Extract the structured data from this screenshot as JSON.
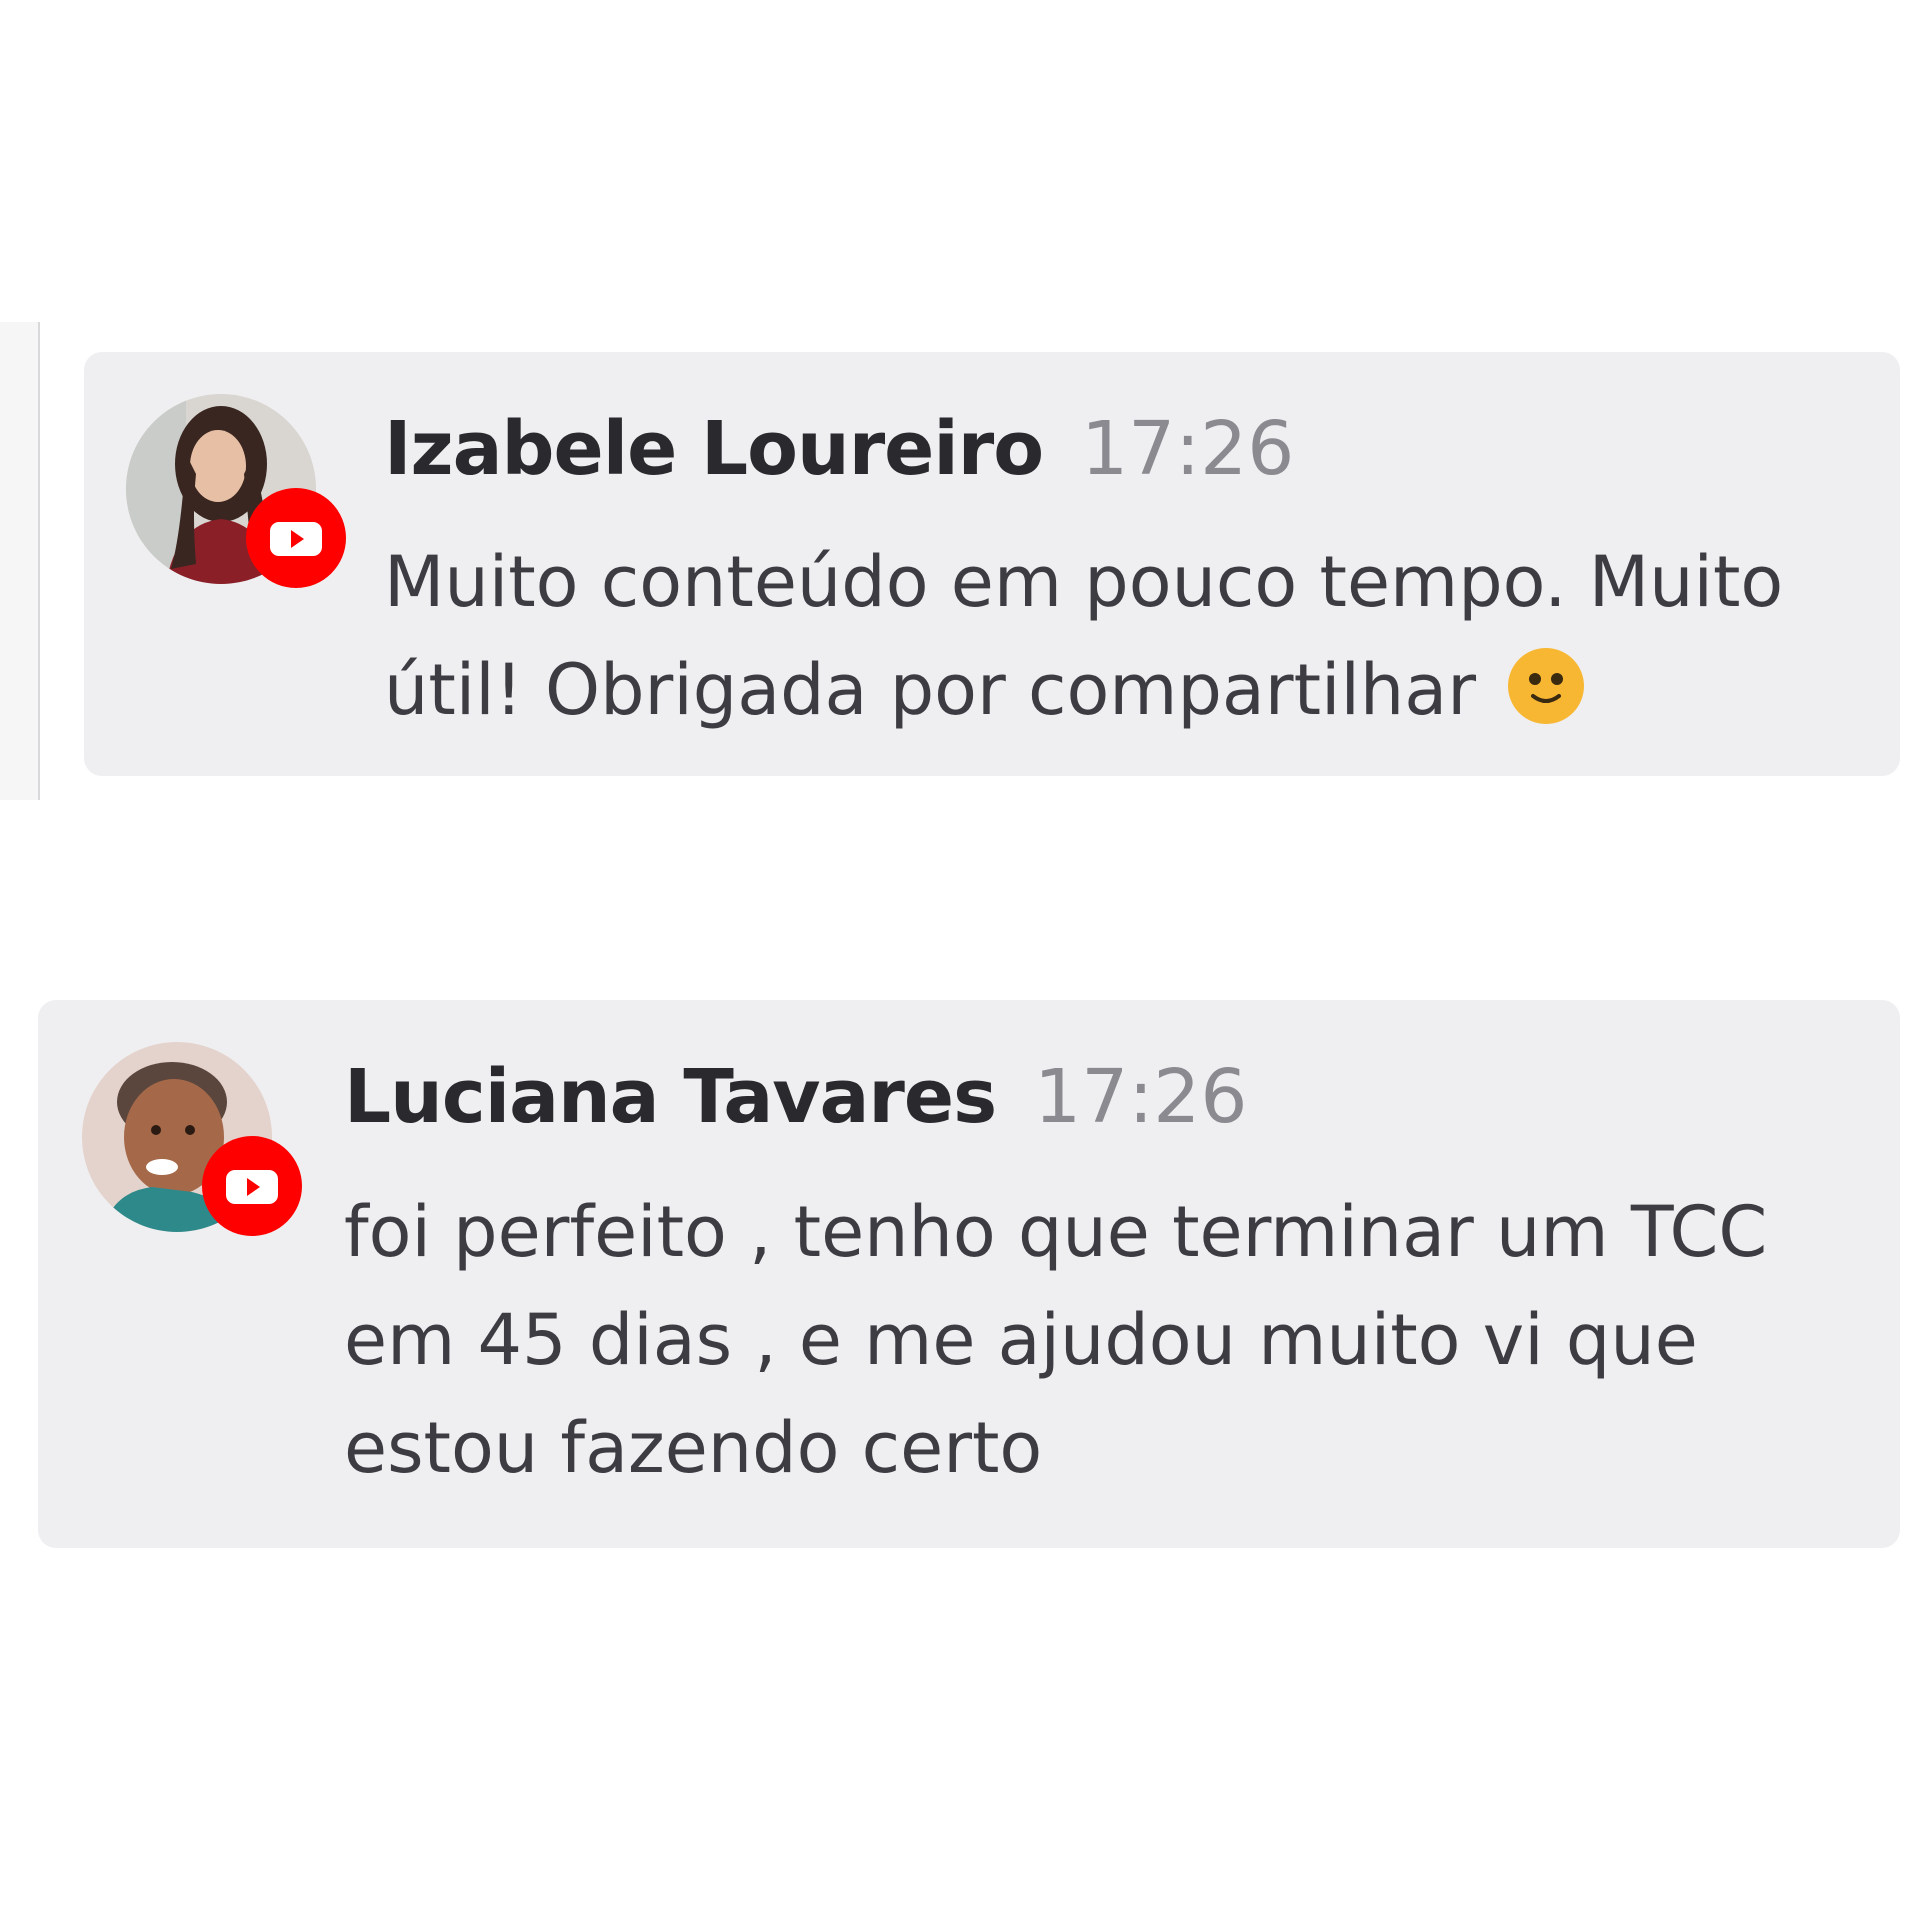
{
  "comments": [
    {
      "author": "Izabele Loureiro",
      "time": "17:26",
      "line_1": "Muito conteúdo em pouco tempo. Muito",
      "line_2": "útil! Obrigada por compartilhar",
      "emoji": "smile-emoji-icon",
      "platform_badge": "youtube-icon"
    },
    {
      "author": "Luciana Tavares",
      "time": "17:26",
      "line_1": "foi perfeito , tenho que terminar um TCC",
      "line_2": "em 45 dias , e me ajudou muito vi que",
      "line_3": "estou fazendo certo",
      "platform_badge": "youtube-icon"
    }
  ],
  "colors": {
    "card_background": "#efeff1",
    "author_text": "#2a2a2e",
    "timestamp_text": "#8a8a90",
    "message_text": "#3c3c42",
    "youtube_red": "#ff0000",
    "emoji_yellow": "#f7b733"
  }
}
